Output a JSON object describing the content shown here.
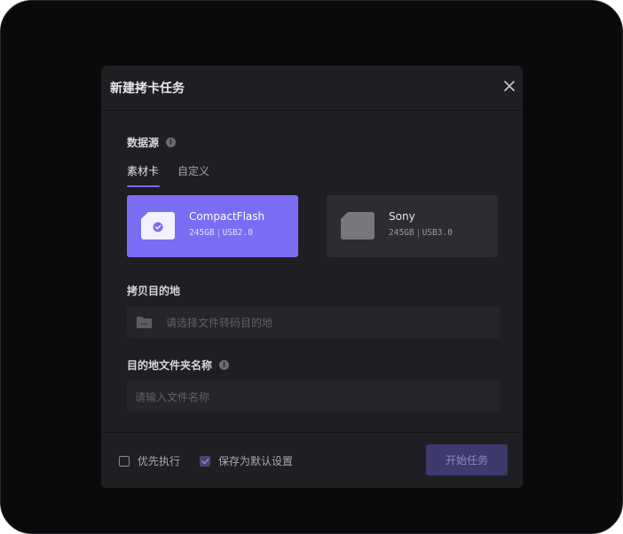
{
  "dialog": {
    "title": "新建拷卡任务",
    "close_icon": "close-icon"
  },
  "source": {
    "label": "数据源",
    "info_icon_glyph": "i",
    "tabs": [
      {
        "label": "素材卡",
        "active": true
      },
      {
        "label": "自定义",
        "active": false
      }
    ],
    "cards": [
      {
        "name": "CompactFlash",
        "size": "245GB",
        "interface": "USB2.0",
        "selected": true,
        "icon": "card-check-icon"
      },
      {
        "name": "Sony",
        "size": "245GB",
        "interface": "USB3.0",
        "selected": false,
        "icon": "card-icon"
      }
    ]
  },
  "destination": {
    "label": "拷贝目的地",
    "placeholder": "请选择文件转码目的地",
    "icon": "folder-icon"
  },
  "folder_name": {
    "label": "目的地文件夹名称",
    "info_icon_glyph": "i",
    "placeholder": "请输入文件名称"
  },
  "footer": {
    "priority_label": "优先执行",
    "priority_checked": false,
    "save_default_label": "保存为默认设置",
    "save_default_checked": true,
    "start_label": "开始任务"
  },
  "colors": {
    "accent": "#7b6cf4",
    "dialog_bg": "#1f1f23",
    "backdrop": "#0a0a0b"
  }
}
